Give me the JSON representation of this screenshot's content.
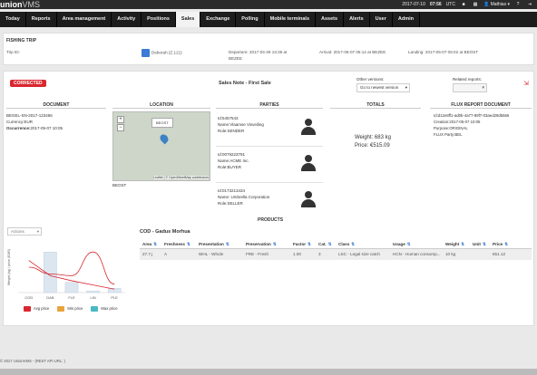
{
  "app": {
    "brand_bold": "union",
    "brand_light": "VMS",
    "datetime": "2017-07-10",
    "time": "07:56",
    "tz": "UTC",
    "user": "Mathias",
    "lock_icon": "lock-icon",
    "lang_icon": "flag-icon"
  },
  "nav": [
    "Today",
    "Reports",
    "Area management",
    "Activity",
    "Positions",
    "Sales",
    "Exchange",
    "Polling",
    "Mobile terminals",
    "Assets",
    "Alerts",
    "User",
    "Admin"
  ],
  "nav_active": "Sales",
  "trip": {
    "title": "FISHING TRIP",
    "trip_id": "Trip ID:",
    "vessel": "Deborah (Z.121)",
    "departure": "Departure: 2017-04-29 13:36 at BEZEE",
    "arrival": "Arrival: 2017-05-07 05:14 at BEZEE",
    "landing": "Landing: 2017-05-07 06:02 at BEOST"
  },
  "note": {
    "badge": "CORRECTED",
    "title": "Sales Note - First Sale",
    "other_versions_label": "Other versions:",
    "other_versions_value": "Go to newest version",
    "related_label": "Related reports:"
  },
  "columns": {
    "document": "DOCUMENT",
    "location": "LOCATION",
    "parties": "PARTIES",
    "totals": "TOTALS",
    "flux": "FLUX REPORT DOCUMENT"
  },
  "document": {
    "id": "BEGEL-SN-2017-123456",
    "currency": "Currency:EUR",
    "occurrence_label": "Occurrence:",
    "occurrence": "2017-05-07 10:05"
  },
  "location": {
    "tooltip": "BEOST",
    "label": "BEOST",
    "attribution": "Leaflet | © OpenStreetMap contributors",
    "zoom_in": "+",
    "zoom_out": "−"
  },
  "parties": [
    {
      "id": "Id:5457543",
      "name": "Name:Vlaamse Visveiling",
      "role": "Role:SENDER"
    },
    {
      "id": "Id:0079223791",
      "name": "Name:ACME Inc.",
      "role": "Role:BUYER"
    },
    {
      "id": "Id:0173213434",
      "name": "Name: Umbrella Corporation",
      "role": "Role:SELLER"
    }
  ],
  "totals": {
    "weight": "Weight: 683 kg",
    "price": "Price: €515.09"
  },
  "flux": {
    "id": "Id:d12e8ff1-ad0b-4a77-89f7-03aed29d5566",
    "creation": "Creation:2017-05-07 10:05",
    "purpose": "Purpose:ORIGINAL",
    "party": "FLUX Party:BEL"
  },
  "products": {
    "header": "PRODUCTS",
    "actions": "Actions",
    "species": "COD - Gadus Morhua"
  },
  "table": {
    "headers": [
      "Area",
      "Freshness",
      "Presentation",
      "Preservation",
      "Factor",
      "Cat.",
      "Class",
      "Usage",
      "Weight",
      "Unit",
      "Price"
    ],
    "rows": [
      [
        "27.7.j",
        "A",
        "WHL - Whole",
        "FRE - Fresh",
        "1.00",
        "3",
        "LSC - Legal size catch",
        "HCN - Human consump...",
        "10 kg",
        "",
        "€51.12"
      ]
    ]
  },
  "chart_data": {
    "type": "bar",
    "categories": [
      "COD",
      "DAB",
      "FLE",
      "LIN",
      "PLE"
    ],
    "ylabel": "Weight (kg) / price (EUR)",
    "series": [
      {
        "name": "Min price",
        "values": [
          0,
          48,
          12,
          2,
          5
        ]
      },
      {
        "name": "Avg price",
        "values": [
          38,
          20,
          14,
          9,
          4
        ]
      },
      {
        "name": "Max price",
        "values": [
          0,
          0,
          0,
          0,
          0
        ]
      }
    ],
    "colors": {
      "avg": "#d9272e",
      "min": "#e8a33d",
      "max": "#4bb8c4"
    },
    "curve_values": [
      30,
      22,
      20,
      48,
      10
    ],
    "ylim": [
      0,
      60
    ]
  },
  "legend": [
    "Avg price",
    "Min price",
    "Max price"
  ],
  "footer": "© 2017 UnionVMS -   (REST API URL: )"
}
